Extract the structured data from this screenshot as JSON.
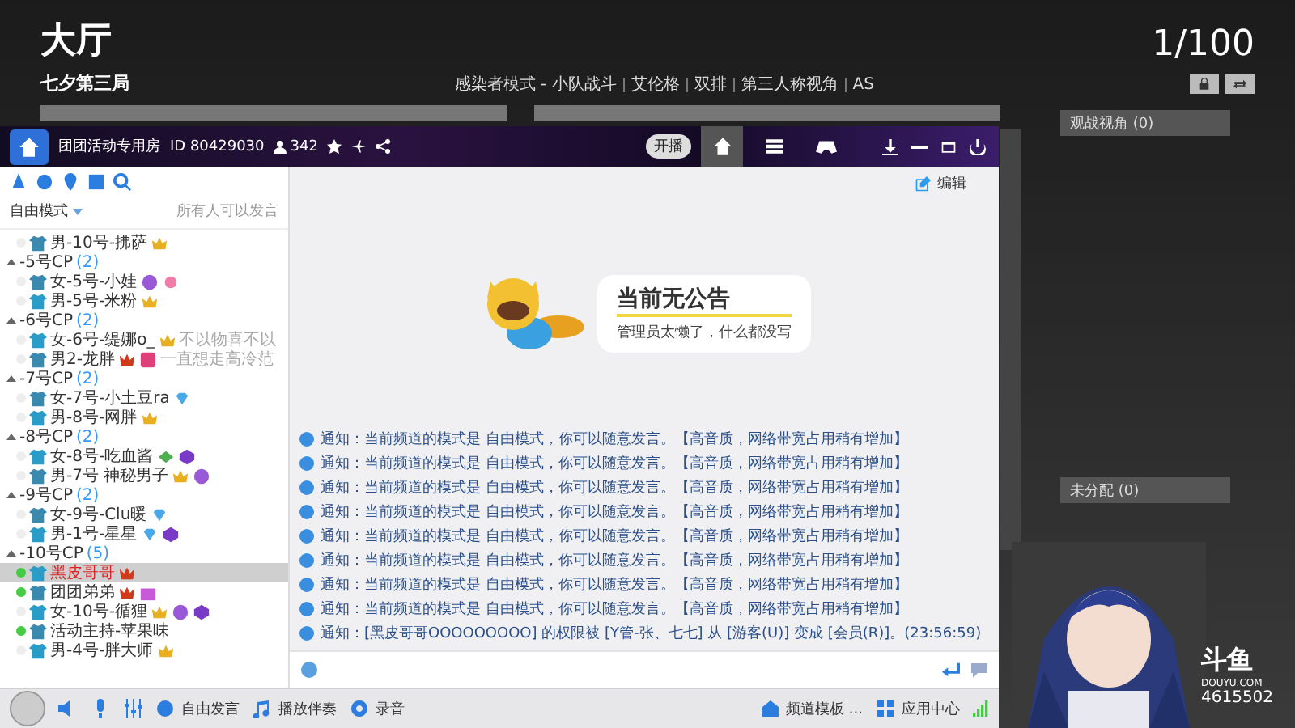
{
  "lobby": {
    "title": "大厅",
    "match_name": "七夕第三局",
    "player_count": "1/100",
    "mode_tags": [
      "感染者模式 - 小队战斗",
      "艾伦格",
      "双排",
      "第三人称视角",
      "AS"
    ],
    "spectator": "观战视角 (0)",
    "unassigned": "未分配 (0)"
  },
  "yy_window": {
    "room_name": "团团活动专用房",
    "room_id": "ID 80429030",
    "online": "342",
    "live_toggle": "开播",
    "nav_tabs": [
      {
        "selected": true
      },
      {
        "selected": false
      },
      {
        "selected": false
      }
    ],
    "sidebar": {
      "mode": "自由模式",
      "mode_note": "所有人可以发言",
      "tree": [
        {
          "kind": "user",
          "name": "男-10号-拂萨"
        },
        {
          "kind": "group",
          "name": "-5号CP",
          "count": "(2)",
          "expanded": true,
          "children": [
            {
              "kind": "user",
              "name": "女-5号-小娃"
            },
            {
              "kind": "user",
              "name": "男-5号-米粉"
            }
          ]
        },
        {
          "kind": "group",
          "name": "-6号CP",
          "count": "(2)",
          "expanded": true,
          "children": [
            {
              "kind": "user",
              "name": "女-6号-缇娜o_",
              "signature": "不以物喜不以"
            },
            {
              "kind": "user",
              "name": "男2-龙胖",
              "signature": "一直想走高冷范"
            }
          ]
        },
        {
          "kind": "group",
          "name": "-7号CP",
          "count": "(2)",
          "expanded": true,
          "children": [
            {
              "kind": "user",
              "name": "女-7号-小土豆ra"
            },
            {
              "kind": "user",
              "name": "男-8号-网胖"
            }
          ]
        },
        {
          "kind": "group",
          "name": "-8号CP",
          "count": "(2)",
          "expanded": true,
          "children": [
            {
              "kind": "user",
              "name": "女-8号-吃血酱"
            },
            {
              "kind": "user",
              "name": "男-7号 神秘男子"
            }
          ]
        },
        {
          "kind": "group",
          "name": "-9号CP",
          "count": "(2)",
          "expanded": true,
          "children": [
            {
              "kind": "user",
              "name": "女-9号-Clu暖"
            },
            {
              "kind": "user",
              "name": "男-1号-星星"
            }
          ]
        },
        {
          "kind": "group",
          "name": "-10号CP",
          "count": "(5)",
          "expanded": true,
          "children": [
            {
              "kind": "user",
              "name": "黑皮哥哥",
              "selected": true,
              "mic": true
            },
            {
              "kind": "user",
              "name": "团团弟弟",
              "selected": false,
              "mic": true
            },
            {
              "kind": "user",
              "name": "女-10号-循狸",
              "selected": false,
              "mic": false
            },
            {
              "kind": "user",
              "name": "活动主持-苹果味",
              "selected": false,
              "mic": true
            },
            {
              "kind": "user",
              "name": "男-4号-胖大师",
              "selected": false,
              "mic": false
            }
          ]
        }
      ]
    },
    "edit_label": "编辑",
    "notice": {
      "title": "当前无公告",
      "subtitle": "管理员太懒了，什么都没写"
    },
    "messages": [
      "通知：当前频道的模式是 自由模式，你可以随意发言。【高音质，网络带宽占用稍有增加】",
      "通知：当前频道的模式是 自由模式，你可以随意发言。【高音质，网络带宽占用稍有增加】",
      "通知：当前频道的模式是 自由模式，你可以随意发言。【高音质，网络带宽占用稍有增加】",
      "通知：当前频道的模式是 自由模式，你可以随意发言。【高音质，网络带宽占用稍有增加】",
      "通知：当前频道的模式是 自由模式，你可以随意发言。【高音质，网络带宽占用稍有增加】",
      "通知：当前频道的模式是 自由模式，你可以随意发言。【高音质，网络带宽占用稍有增加】",
      "通知：当前频道的模式是 自由模式，你可以随意发言。【高音质，网络带宽占用稍有增加】",
      "通知：当前频道的模式是 自由模式，你可以随意发言。【高音质，网络带宽占用稍有增加】",
      "通知：[黑皮哥哥OOOOOOOOO] 的权限被 [Y管-张、七七] 从 [游客(U)] 变成 [会员(R)]。(23:56:59)"
    ],
    "bottom_left": [
      "自由发言",
      "播放伴奏",
      "录音"
    ],
    "bottom_right": [
      "频道模板 ...",
      "应用中心"
    ]
  },
  "stream": {
    "logo": "斗鱼",
    "logo_sub": "DOUYU.COM",
    "room_number": "4615502"
  }
}
